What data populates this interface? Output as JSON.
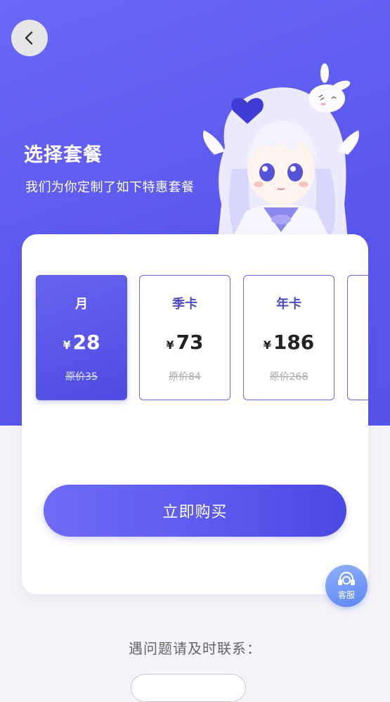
{
  "header": {
    "title": "选择套餐",
    "subtitle": "我们为你定制了如下特惠套餐",
    "back_icon": "chevron-left-icon"
  },
  "plans": [
    {
      "name": "月",
      "currency": "¥",
      "price": "28",
      "original": "原价35",
      "selected": true
    },
    {
      "name": "季卡",
      "currency": "¥",
      "price": "73",
      "original": "原价84",
      "selected": false
    },
    {
      "name": "年卡",
      "currency": "¥",
      "price": "186",
      "original": "原价268",
      "selected": false
    }
  ],
  "buy_button": {
    "label": "立即购买"
  },
  "service": {
    "label": "客服",
    "icon": "headset-icon"
  },
  "contact": {
    "label": "遇问题请及时联系："
  },
  "colors": {
    "accent": "#5b57ee",
    "hero_bg": "#6a68f7",
    "service": "#6f95f5"
  }
}
